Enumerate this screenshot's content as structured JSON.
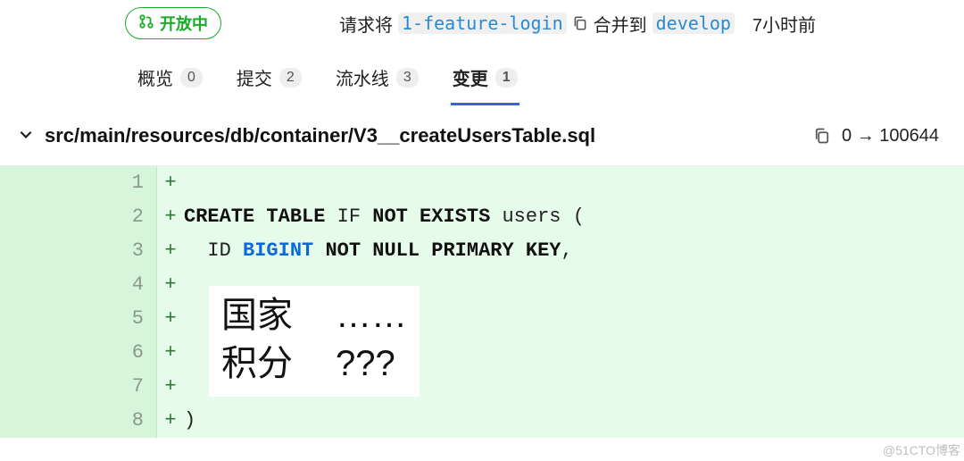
{
  "header": {
    "status_label": "开放中",
    "merge_prefix": "请求将",
    "source_branch": "1-feature-login",
    "merge_mid": "合并到",
    "target_branch": "develop",
    "time_ago": "7小时前"
  },
  "tabs": [
    {
      "label": "概览",
      "count": "0"
    },
    {
      "label": "提交",
      "count": "2"
    },
    {
      "label": "流水线",
      "count": "3"
    },
    {
      "label": "变更",
      "count": "1"
    }
  ],
  "active_tab_index": 3,
  "file": {
    "path": "src/main/resources/db/container/V3__createUsersTable.sql",
    "mode_from": "0",
    "mode_arrow": "→",
    "mode_to": "100644"
  },
  "diff_lines": [
    {
      "num": "1",
      "mark": "+",
      "code": ""
    },
    {
      "num": "2",
      "mark": "+",
      "code_html": "<span class='kw'>CREATE TABLE</span> IF <span class='kw'>NOT EXISTS</span> users ("
    },
    {
      "num": "3",
      "mark": "+",
      "code_html": "  ID <span class='ty'>BIGINT</span> <span class='kw'>NOT NULL PRIMARY KEY</span>,"
    },
    {
      "num": "4",
      "mark": "+",
      "code": ""
    },
    {
      "num": "5",
      "mark": "+",
      "code": ""
    },
    {
      "num": "6",
      "mark": "+",
      "code": ""
    },
    {
      "num": "7",
      "mark": "+",
      "code": ""
    },
    {
      "num": "8",
      "mark": "+",
      "code": ")"
    }
  ],
  "overlay": {
    "row1_left": "国家",
    "row1_right": "……",
    "row2_left": "积分",
    "row2_right": "???"
  },
  "watermark": "@51CTO博客"
}
